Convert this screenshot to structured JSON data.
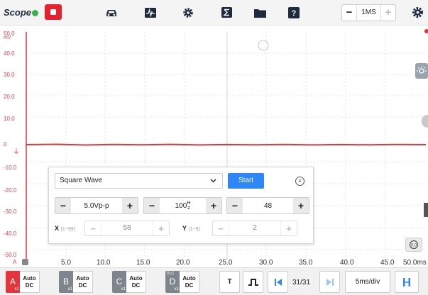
{
  "app": {
    "brand": "Scope"
  },
  "toolbar": {
    "icons": [
      "stop-icon",
      "car-icon",
      "waveform-icon",
      "gear-icon",
      "sigma-icon",
      "folder-icon",
      "help-icon",
      "settings-gear-icon"
    ],
    "timebase": {
      "minus": "−",
      "value": "1MS",
      "plus": "+"
    }
  },
  "plot": {
    "y_unit": "mV",
    "y_ticks": [
      "50.0",
      "40.0",
      "30.0",
      "20.0",
      "10.0",
      "0",
      "-10.0",
      "-20.0",
      "-30.0",
      "-40.0",
      "-50.0"
    ],
    "x_ticks": [
      "5.0",
      "10.0",
      "15.0",
      "20.0",
      "25.0",
      "30.0",
      "35.0",
      "40.0",
      "45.0",
      "50.0ms"
    ],
    "channel_label": "A",
    "trace_color": "#d93a3a",
    "ground_marker": "⏚"
  },
  "generator": {
    "waveform": "Square Wave",
    "start_label": "Start",
    "close_symbol": "⊗",
    "amplitude": "5.0Vp-p",
    "frequency_value": "100",
    "frequency_unit_top": "H",
    "frequency_unit_bottom": "z",
    "duty": "48",
    "x_label": "X",
    "x_range": "(1~99)",
    "x_value": "58",
    "y_label": "Y",
    "y_range": "(1~9)",
    "y_value": "2",
    "minus": "−",
    "plus": "+"
  },
  "bottom": {
    "channels": [
      {
        "letter": "A",
        "mode": "Auto",
        "coupling": "DC",
        "probe": "x1",
        "color": "#e3353e"
      },
      {
        "letter": "B",
        "mode": "Auto",
        "coupling": "DC",
        "probe": "x1",
        "color": "#7e858c"
      },
      {
        "letter": "C",
        "mode": "Auto",
        "coupling": "DC",
        "probe": "x1",
        "color": "#7e858c"
      },
      {
        "letter": "D",
        "mode": "Auto",
        "coupling": "DC",
        "probe": "x1",
        "dlc": "DLC",
        "color": "#7e858c"
      }
    ],
    "trigger_label": "T",
    "page": "31/31",
    "timediv": "5ms/div"
  }
}
